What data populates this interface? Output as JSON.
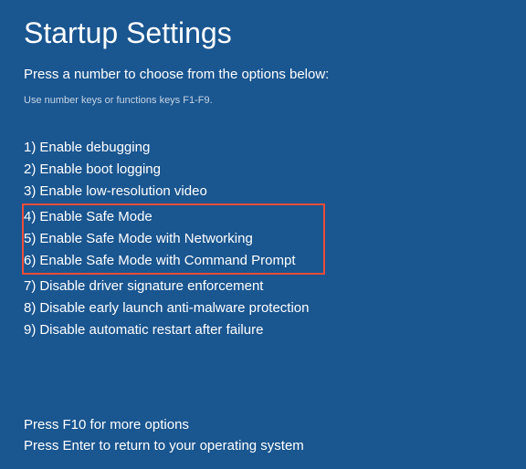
{
  "title": "Startup Settings",
  "subtitle": "Press a number to choose from the options below:",
  "hint": "Use number keys or functions keys F1-F9.",
  "options": [
    {
      "num": "1)",
      "label": "Enable debugging",
      "highlighted": false
    },
    {
      "num": "2)",
      "label": "Enable boot logging",
      "highlighted": false
    },
    {
      "num": "3)",
      "label": "Enable low-resolution video",
      "highlighted": false
    },
    {
      "num": "4)",
      "label": "Enable Safe Mode",
      "highlighted": true
    },
    {
      "num": "5)",
      "label": "Enable Safe Mode with Networking",
      "highlighted": true
    },
    {
      "num": "6)",
      "label": "Enable Safe Mode with Command Prompt",
      "highlighted": true
    },
    {
      "num": "7)",
      "label": "Disable driver signature enforcement",
      "highlighted": false
    },
    {
      "num": "8)",
      "label": "Disable early launch anti-malware protection",
      "highlighted": false
    },
    {
      "num": "9)",
      "label": "Disable automatic restart after failure",
      "highlighted": false
    }
  ],
  "footer": {
    "line1": "Press F10 for more options",
    "line2": "Press Enter to return to your operating system"
  },
  "colors": {
    "background": "#1a5690",
    "text": "#ffffff",
    "highlight_border": "#ed4c3a"
  }
}
